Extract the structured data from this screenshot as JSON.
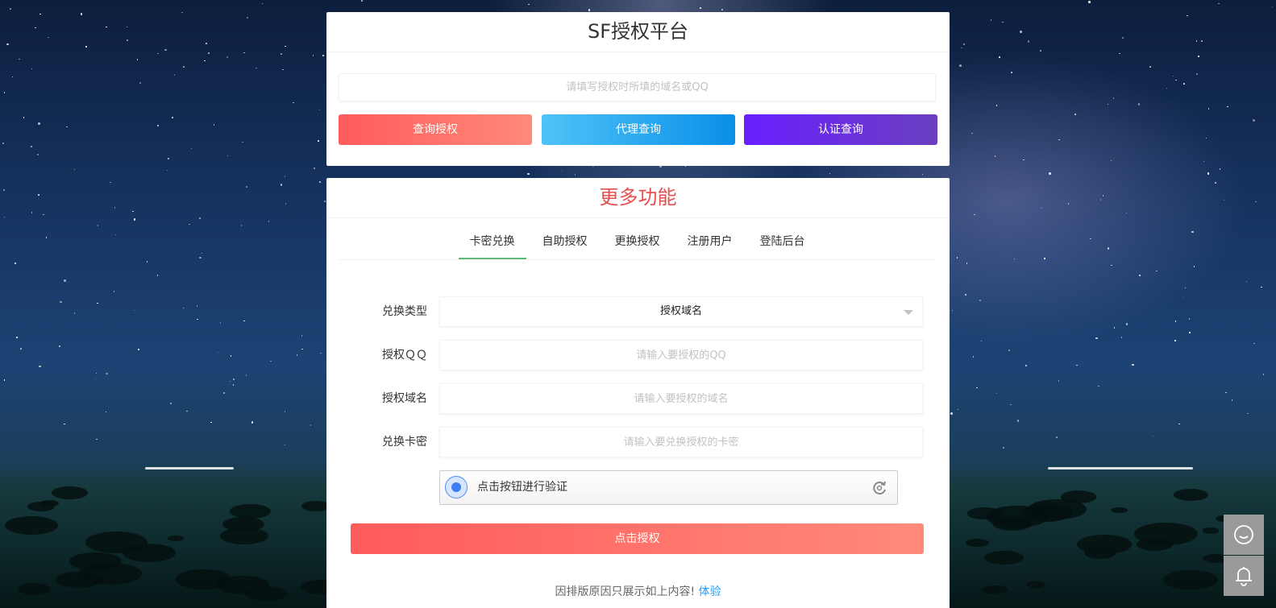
{
  "top_card": {
    "title": "SF授权平台",
    "search_placeholder": "请填写授权时所填的域名或QQ",
    "buttons": [
      "查询授权",
      "代理查询",
      "认证查询"
    ]
  },
  "bottom_card": {
    "title": "更多功能",
    "tabs": [
      {
        "label": "卡密兑换",
        "active": true
      },
      {
        "label": "自助授权",
        "active": false
      },
      {
        "label": "更换授权",
        "active": false
      },
      {
        "label": "注册用户",
        "active": false
      },
      {
        "label": "登陆后台",
        "active": false
      }
    ],
    "form": {
      "type_label": "兑换类型",
      "type_value": "授权域名",
      "qq_label": "授权ＱＱ",
      "qq_placeholder": "请输入要授权的QQ",
      "domain_label": "授权域名",
      "domain_placeholder": "请输入要授权的域名",
      "card_label": "兑换卡密",
      "card_placeholder": "请输入要兑换授权的卡密"
    },
    "verify_text": "点击按钮进行验证",
    "submit_label": "点击授权",
    "footnote_text": "因排版原因只展示如上内容!",
    "footnote_link": "体验"
  },
  "floating": {
    "chat_icon": "smile-chat-icon",
    "bell_icon": "bell-icon"
  },
  "colors": {
    "red_gradient": [
      "#ff5b5b",
      "#ff8a7a"
    ],
    "blue_gradient": [
      "#4fc3f7",
      "#0a8fe8"
    ],
    "purple_gradient": [
      "#6a1fff",
      "#6a3fbf"
    ],
    "active_tab_underline": "#5fb878",
    "section_title": "#e84e4e",
    "link": "#1e9fff"
  }
}
